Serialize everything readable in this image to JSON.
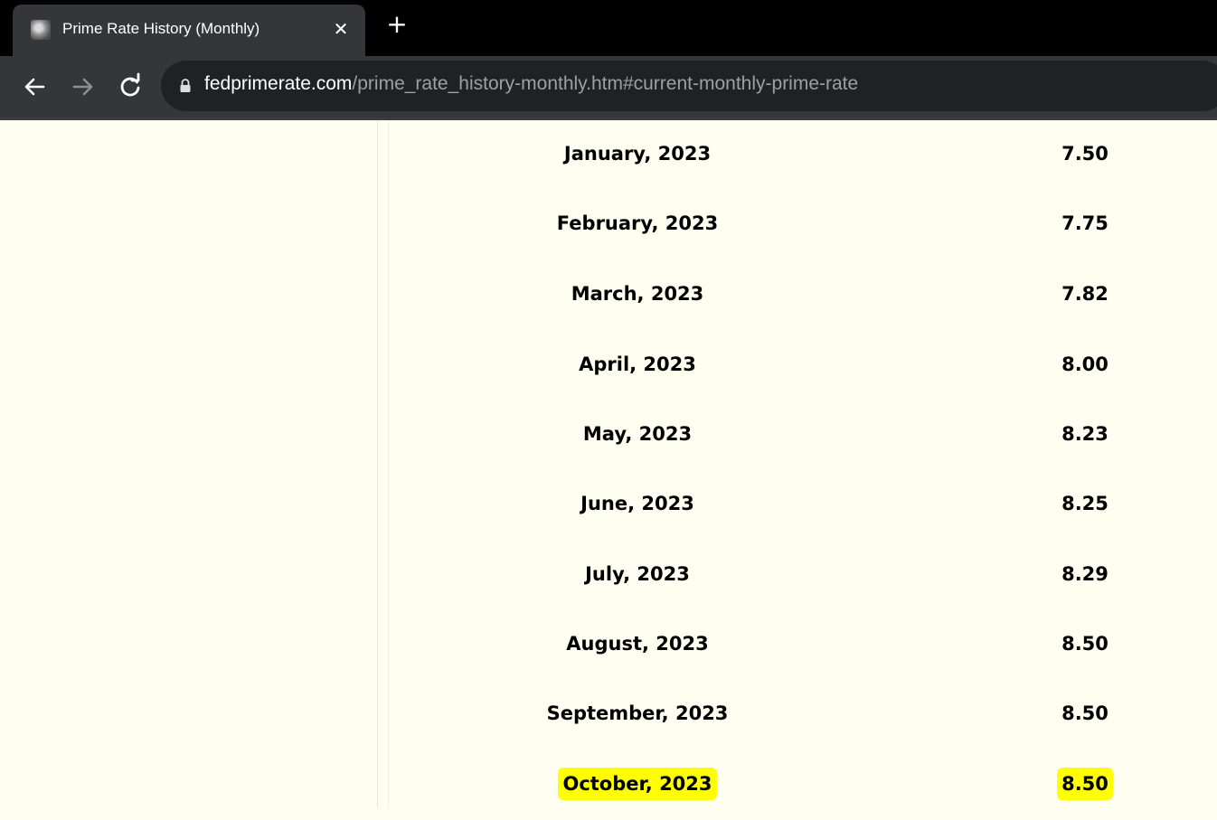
{
  "browser": {
    "tab_title": "Prime Rate History (Monthly)",
    "tab_close": "✕",
    "new_tab": "+",
    "url_host": "fedprimerate.com",
    "url_path": "/prime_rate_history-monthly.htm#current-monthly-prime-rate"
  },
  "rates": [
    {
      "month": "January, 2023",
      "rate": "7.50"
    },
    {
      "month": "February, 2023",
      "rate": "7.75"
    },
    {
      "month": "March, 2023",
      "rate": "7.82"
    },
    {
      "month": "April, 2023",
      "rate": "8.00"
    },
    {
      "month": "May, 2023",
      "rate": "8.23"
    },
    {
      "month": "June, 2023",
      "rate": "8.25"
    },
    {
      "month": "July, 2023",
      "rate": "8.29"
    },
    {
      "month": "August, 2023",
      "rate": "8.50"
    },
    {
      "month": "September, 2023",
      "rate": "8.50"
    },
    {
      "month": "October, 2023",
      "rate": "8.50"
    }
  ],
  "colors": {
    "page_background": "#fefff0",
    "highlight": "#ffff00"
  }
}
